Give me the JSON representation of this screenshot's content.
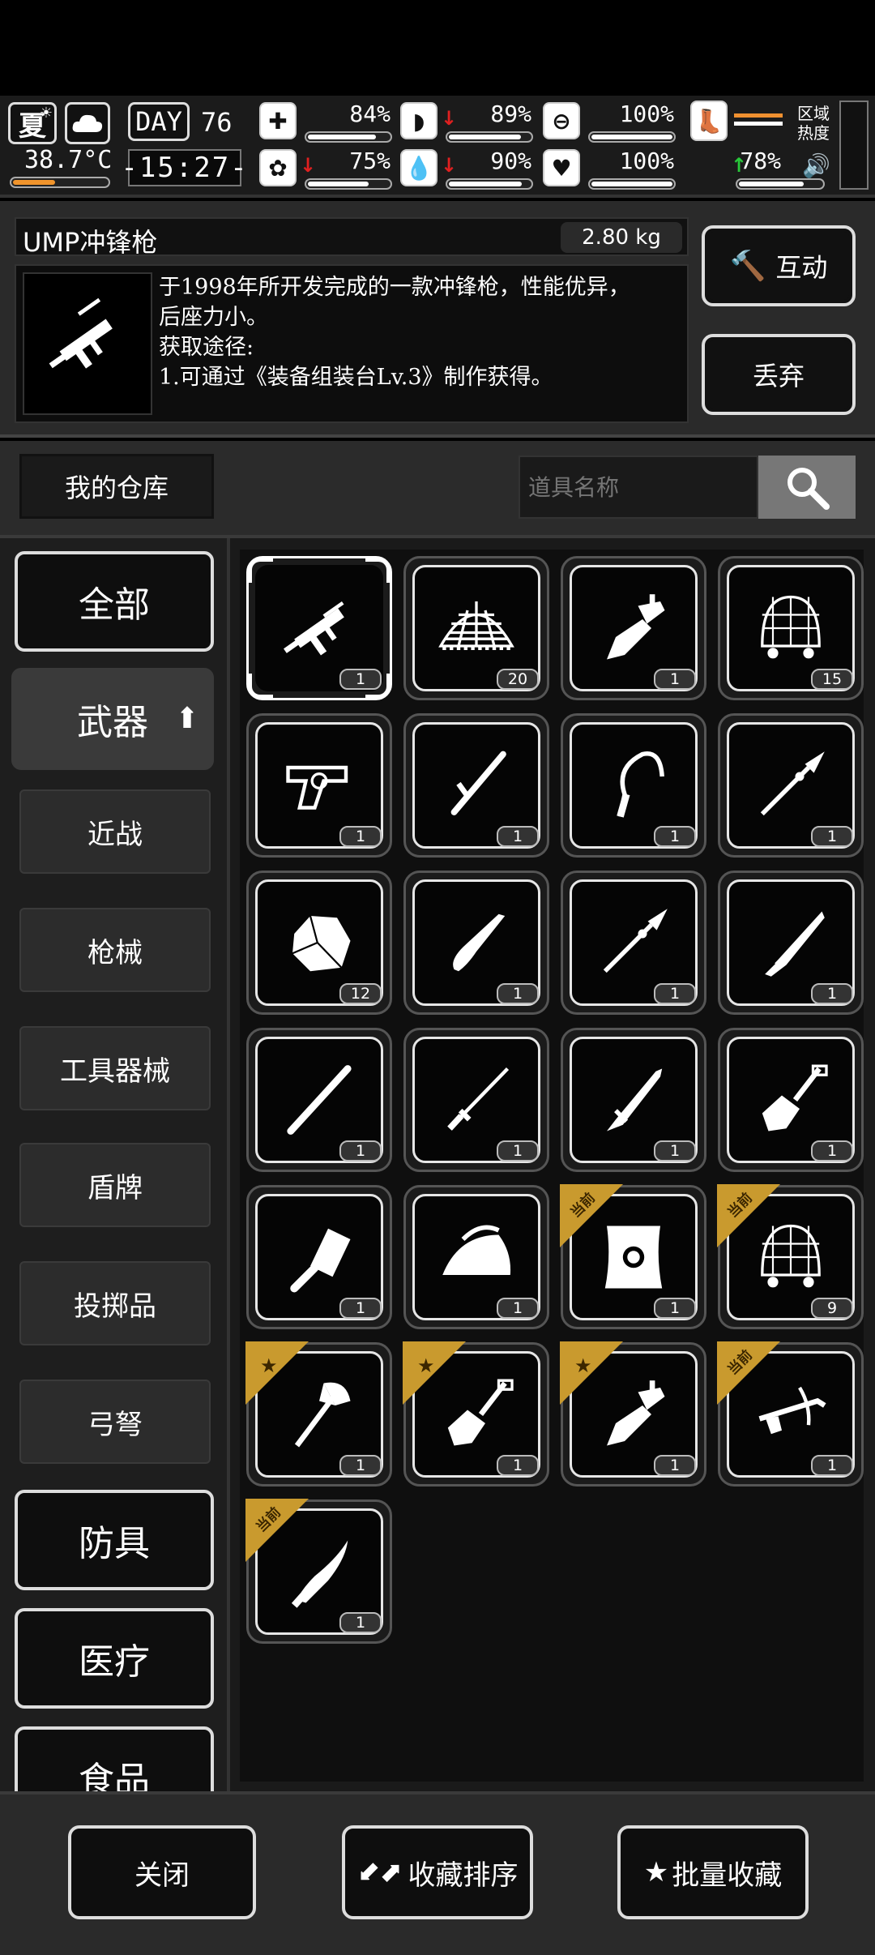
{
  "status": {
    "season": "夏",
    "temperature": "38.7°C",
    "temp_level": 0.45,
    "day_label": "DAY",
    "day_number": "76",
    "time": "-15:27-",
    "stats": [
      {
        "icon": "medkit-icon",
        "arrow": "",
        "value": "84%",
        "level": 0.84
      },
      {
        "icon": "stomach-icon",
        "arrow": "down",
        "value": "89%",
        "level": 0.89
      },
      {
        "icon": "capsule-icon",
        "arrow": "",
        "value": "100%",
        "level": 1.0
      },
      {
        "icon": "brain-icon",
        "arrow": "down",
        "value": "75%",
        "level": 0.75
      },
      {
        "icon": "water-drop-icon",
        "arrow": "down",
        "value": "90%",
        "level": 0.9
      },
      {
        "icon": "heart-icon",
        "arrow": "",
        "value": "100%",
        "level": 1.0
      },
      {
        "icon": "shoe-icon",
        "arrow": "up",
        "value": "78%",
        "level": 0.78
      }
    ],
    "area_heat_label": "区域热度"
  },
  "detail": {
    "item_name": "UMP冲锋枪",
    "weight": "2.80 kg",
    "description_lines": [
      "于1998年所开发完成的一款冲锋枪，性能优异，",
      "后座力小。",
      "获取途径:",
      "1.可通过《装备组装台Lv.3》制作获得。"
    ],
    "interact_label": "互动",
    "drop_label": "丢弃"
  },
  "warehouse": {
    "title": "我的仓库",
    "search_placeholder": "道具名称"
  },
  "categories": {
    "all": "全部",
    "weapons": "武器",
    "subs": [
      "近战",
      "枪械",
      "工具器械",
      "盾牌",
      "投掷品",
      "弓弩"
    ],
    "armor": "防具",
    "medical": "医疗",
    "food": "食品"
  },
  "items": [
    {
      "icon": "smg-icon",
      "count": "1",
      "badge": ""
    },
    {
      "icon": "net-icon",
      "count": "20",
      "badge": ""
    },
    {
      "icon": "multitool-icon",
      "count": "1",
      "badge": ""
    },
    {
      "icon": "hairnet-icon",
      "count": "15",
      "badge": ""
    },
    {
      "icon": "revolver-icon",
      "count": "1",
      "badge": ""
    },
    {
      "icon": "baton-icon",
      "count": "1",
      "badge": ""
    },
    {
      "icon": "sickle-icon",
      "count": "1",
      "badge": ""
    },
    {
      "icon": "spear-icon",
      "count": "1",
      "badge": ""
    },
    {
      "icon": "rock-icon",
      "count": "12",
      "badge": ""
    },
    {
      "icon": "folding-knife-icon",
      "count": "1",
      "badge": ""
    },
    {
      "icon": "spear-icon",
      "count": "1",
      "badge": ""
    },
    {
      "icon": "machete-icon",
      "count": "1",
      "badge": ""
    },
    {
      "icon": "bat-icon",
      "count": "1",
      "badge": ""
    },
    {
      "icon": "sword-icon",
      "count": "1",
      "badge": ""
    },
    {
      "icon": "bayonet-icon",
      "count": "1",
      "badge": ""
    },
    {
      "icon": "shovel-icon",
      "count": "1",
      "badge": ""
    },
    {
      "icon": "cleaver-icon",
      "count": "1",
      "badge": ""
    },
    {
      "icon": "iron-icon",
      "count": "1",
      "badge": ""
    },
    {
      "icon": "shield-icon",
      "count": "1",
      "badge": "当前"
    },
    {
      "icon": "hairnet-icon",
      "count": "9",
      "badge": "当前"
    },
    {
      "icon": "axe-icon",
      "count": "1",
      "badge": "star"
    },
    {
      "icon": "shovel-icon",
      "count": "1",
      "badge": "star"
    },
    {
      "icon": "multitool-icon",
      "count": "1",
      "badge": "star"
    },
    {
      "icon": "crossbow-icon",
      "count": "1",
      "badge": "当前"
    },
    {
      "icon": "curved-knife-icon",
      "count": "1",
      "badge": "当前"
    }
  ],
  "footer": {
    "close": "关闭",
    "sort": "收藏排序",
    "batch": "批量收藏"
  }
}
